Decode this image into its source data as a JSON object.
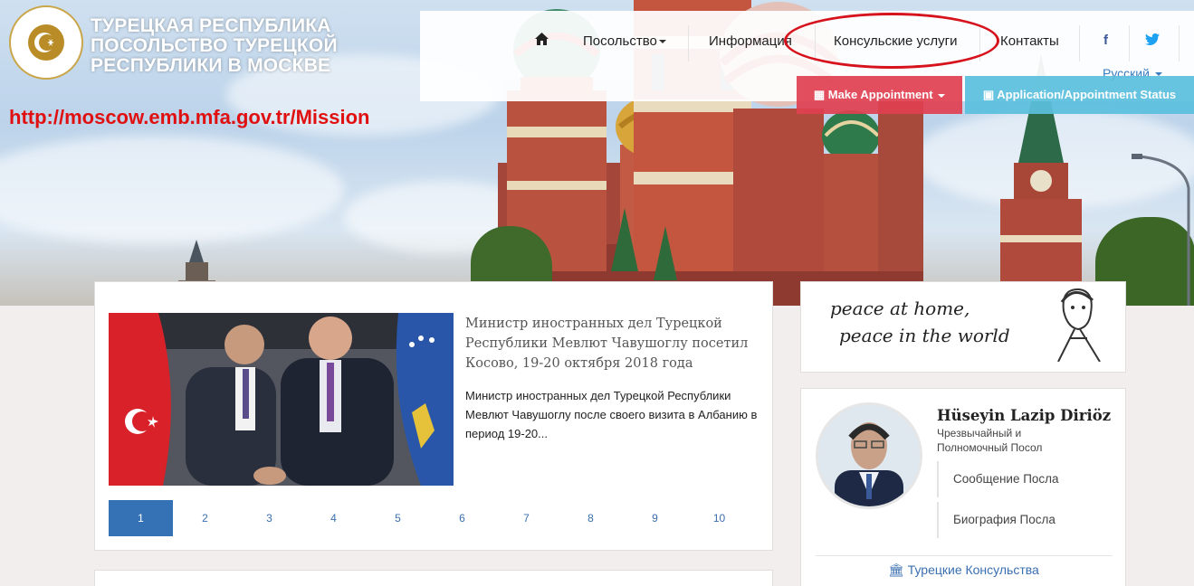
{
  "header": {
    "title_lines": [
      "ТУРЕЦКАЯ РЕСПУБЛИКА",
      "ПОСОЛЬСТВО ТУРЕЦКОЙ",
      "РЕСПУБЛИКИ В МОСКВЕ"
    ],
    "emblem_text": "TÜRKİYE CUMHURİYETİ DIŞİŞLERİ BAKANLIĞI",
    "mission_url": "http://moscow.emb.mfa.gov.tr/Mission"
  },
  "nav": {
    "home_icon": "home-icon",
    "items": [
      "Посольство",
      "Информация",
      "Консульские услуги",
      "Контакты"
    ],
    "language": "Русский",
    "facebook": "f",
    "twitter": "twitter-icon"
  },
  "buttons": {
    "make_appointment": "Make Appointment",
    "application_status": "Application/Appointment Status"
  },
  "news": {
    "title": "Министр иностранных дел Турецкой Республики Мевлют Чавушоглу посетил Косово, 19-20 октября 2018 года",
    "summary": "Министр иностранных дел Турецкой Республики Мевлют Чавушоглу после своего визита в Албанию в период 19-20...",
    "pages": [
      "1",
      "2",
      "3",
      "4",
      "5",
      "6",
      "7",
      "8",
      "9",
      "10"
    ],
    "active_page": "1"
  },
  "sidebar": {
    "quote_line1": "peace at home,",
    "quote_line2": "peace in the world",
    "ambassador": {
      "name": "Hüseyin Lazip Diriöz",
      "role": "Чрезвычайный и Полномочный Посол",
      "links": [
        "Сообщение Посла",
        "Биография Посла"
      ]
    },
    "consulates_link": "Турецкие Консульства"
  },
  "colors": {
    "appointment": "#e04050",
    "status": "#5bc0de",
    "active_page": "#3572b5",
    "url_red": "#e01010",
    "link_blue": "#3a6fb0"
  }
}
